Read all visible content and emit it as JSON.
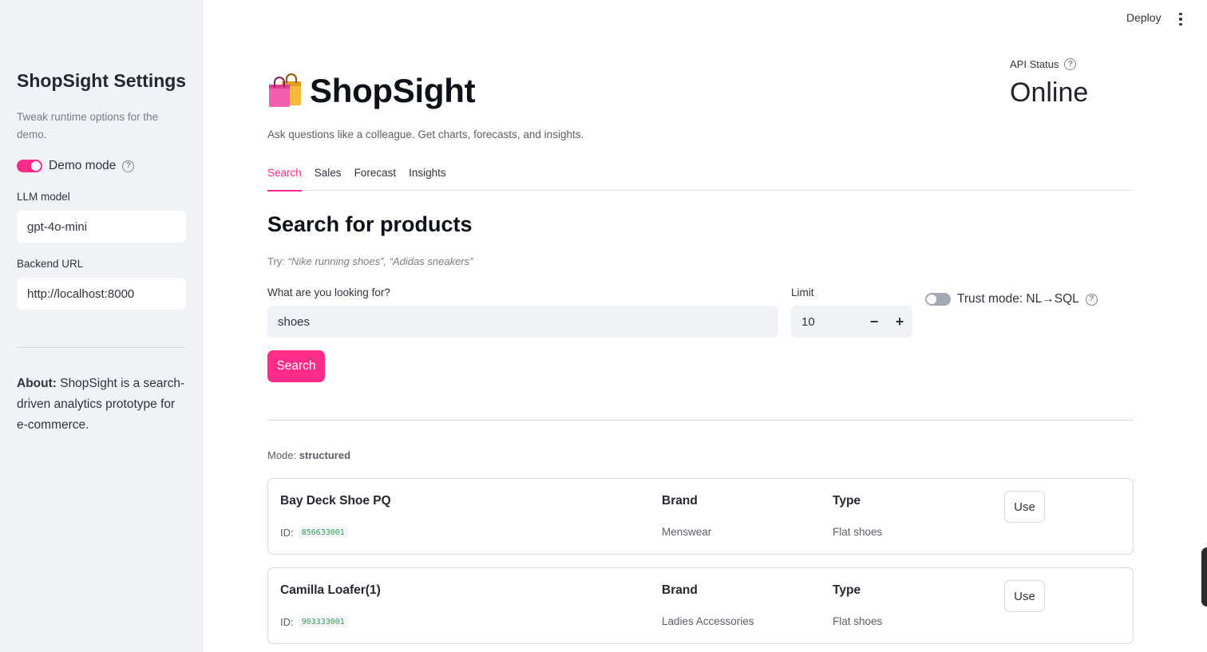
{
  "header": {
    "deploy_label": "Deploy",
    "menu_icon": "kebab-menu-icon"
  },
  "sidebar": {
    "title": "ShopSight Settings",
    "caption": "Tweak runtime options for the demo.",
    "demo_mode": {
      "label": "Demo mode",
      "enabled": true
    },
    "llm_model": {
      "label": "LLM model",
      "value": "gpt-4o-mini"
    },
    "backend_url": {
      "label": "Backend URL",
      "value": "http://localhost:8000"
    },
    "about": {
      "bold": "About:",
      "text": " ShopSight is a search-driven analytics prototype for e-commerce."
    }
  },
  "main": {
    "title": "ShopSight",
    "title_icon": "shopping-bags-icon",
    "subtitle": "Ask questions like a colleague. Get charts, forecasts, and insights.",
    "api_status": {
      "label": "API Status",
      "value": "Online"
    },
    "tabs": [
      {
        "label": "Search",
        "active": true
      },
      {
        "label": "Sales",
        "active": false
      },
      {
        "label": "Forecast",
        "active": false
      },
      {
        "label": "Insights",
        "active": false
      }
    ],
    "section_title": "Search for products",
    "try": {
      "prefix": "Try: ",
      "examples": "“Nike running shoes”, “Adidas sneakers”"
    },
    "query": {
      "label": "What are you looking for?",
      "value": "shoes"
    },
    "limit": {
      "label": "Limit",
      "value": "10",
      "minus": "−",
      "plus": "+"
    },
    "trust_mode": {
      "label": "Trust mode: NL→SQL",
      "enabled": false
    },
    "search_button": "Search",
    "mode": {
      "prefix": "Mode: ",
      "value": "structured"
    },
    "results": [
      {
        "name": "Bay Deck Shoe PQ",
        "id_label": "ID:",
        "id": "856633001",
        "brand_label": "Brand",
        "brand": "Menswear",
        "type_label": "Type",
        "type": "Flat shoes",
        "button": "Use"
      },
      {
        "name": "Camilla Loafer(1)",
        "id_label": "ID:",
        "id": "903333001",
        "brand_label": "Brand",
        "brand": "Ladies Accessories",
        "type_label": "Type",
        "type": "Flat shoes",
        "button": "Use"
      }
    ]
  },
  "colors": {
    "accent": "#ff2b8a",
    "sidebar_bg": "#f0f2f6",
    "code_green": "#3a9e5c"
  }
}
